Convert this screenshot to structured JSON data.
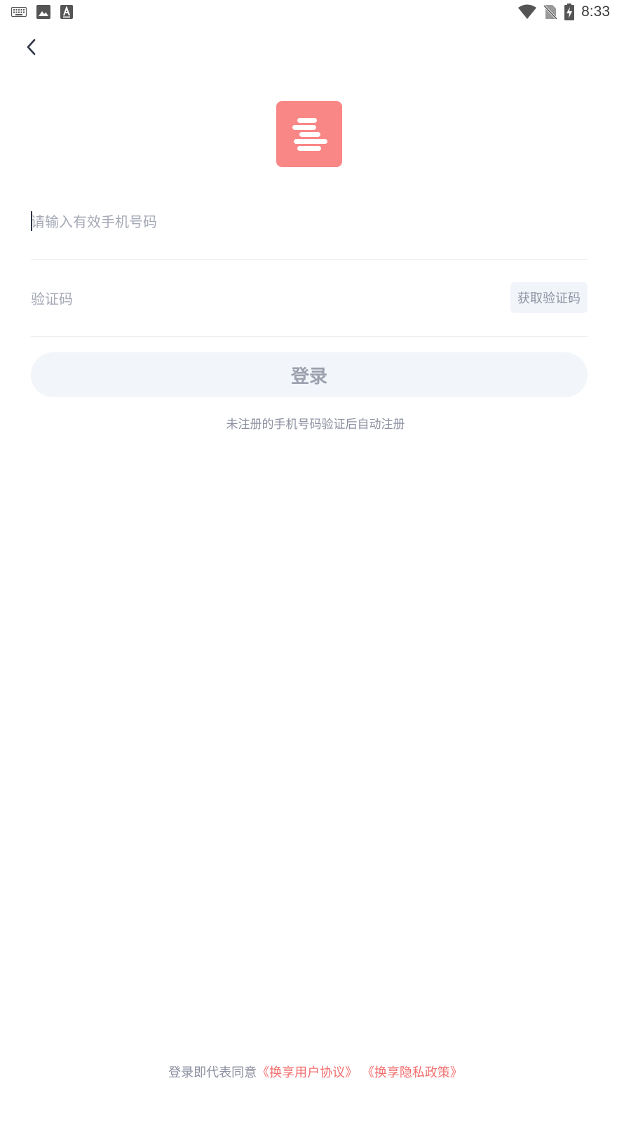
{
  "status_bar": {
    "time": "8:33",
    "left_icons": [
      "keyboard-icon",
      "image-icon",
      "text-a-icon"
    ],
    "right_icons": [
      "wifi-icon",
      "no-sim-icon",
      "battery-charging-icon"
    ]
  },
  "nav": {
    "back_icon": "chevron-left-icon"
  },
  "logo": {
    "color": "#f98786"
  },
  "form": {
    "phone_placeholder": "请输入有效手机号码",
    "code_placeholder": "验证码",
    "get_code_label": "获取验证码",
    "login_label": "登录",
    "hint": "未注册的手机号码验证后自动注册"
  },
  "agreement": {
    "prefix": "登录即代表同意",
    "user_agreement": "《换享用户协议》",
    "privacy_policy": "《换享隐私政策》",
    "link_color": "#f16f6e"
  }
}
